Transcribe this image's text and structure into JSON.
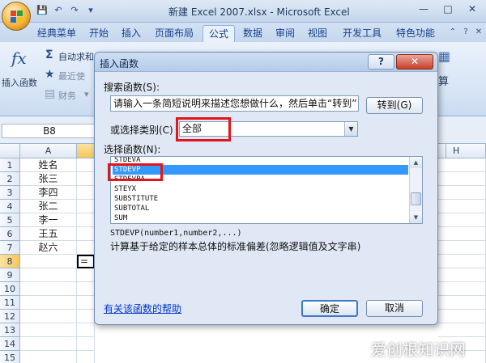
{
  "window": {
    "title": "新建 Excel 2007.xlsx - Microsoft Excel",
    "min": "—",
    "max": "□",
    "close": "✕"
  },
  "ribbon": {
    "tabs": [
      "经典菜单",
      "开始",
      "插入",
      "页面布局",
      "公式",
      "数据",
      "审阅",
      "视图",
      "开发工具",
      "特色功能"
    ],
    "active_tab": "公式",
    "insert_function": "插入函数",
    "autosum": "自动求和",
    "recent": "最近使",
    "finance": "财务",
    "right_partial": "算"
  },
  "formula_bar": {
    "name_box": "B8"
  },
  "sheet": {
    "columns": [
      "A",
      "H"
    ],
    "rows": [
      "1",
      "2",
      "3",
      "4",
      "5",
      "6",
      "7",
      "8",
      "9",
      "10",
      "11",
      "12",
      "13",
      "14",
      "15"
    ],
    "column_a_values": [
      "姓名",
      "张三",
      "李四",
      "张二",
      "李一",
      "王五",
      "赵六"
    ],
    "active_cell_value": "="
  },
  "dialog": {
    "title": "插入函数",
    "help": "?",
    "close": "✕",
    "search_label": "搜索函数(S):",
    "search_value": "请输入一条简短说明来描述您想做什么，然后单击“转到”",
    "goto_button": "转到(G)",
    "category_label": "或选择类别(C)",
    "category_value": "全部",
    "function_list_label": "选择函数(N):",
    "functions": [
      "STDEVA",
      "STDEVP",
      "STDEVPA",
      "STEYX",
      "SUBSTITUTE",
      "SUBTOTAL",
      "SUM"
    ],
    "selected_function": "STDEVP",
    "signature": "STDEVP(number1,number2,...)",
    "description": "计算基于给定的样本总体的标准偏差(忽略逻辑值及文字串)",
    "help_link": "有关该函数的帮助",
    "ok_button": "确定",
    "cancel_button": "取消"
  },
  "watermark": "爱创根知识网",
  "colors": {
    "highlight_red": "#e3151b",
    "selection_blue": "#3399ff",
    "link_blue": "#0033cc"
  }
}
